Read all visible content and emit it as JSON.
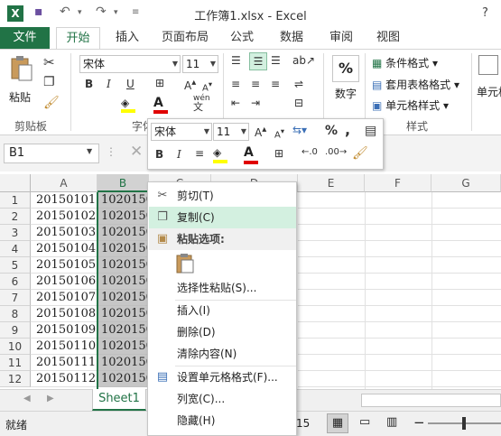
{
  "window": {
    "title": "工作簿1.xlsx - Excel",
    "help": "?"
  },
  "tabs": [
    "文件",
    "开始",
    "插入",
    "页面布局",
    "公式",
    "数据",
    "审阅",
    "视图"
  ],
  "ribbon": {
    "paste_label": "粘贴",
    "clipboard_label": "剪贴板",
    "font_group_label": "字体",
    "font_name": "宋体",
    "font_size": "11",
    "number_label": "数字",
    "cond_format": "条件格式",
    "table_format": "套用表格格式",
    "cell_style": "单元格样式",
    "style_label": "样式",
    "cells_label": "单元格",
    "wen": "wén",
    "percent": "%"
  },
  "formula_bar": {
    "name_box": "B1"
  },
  "columns": [
    "A",
    "B",
    "C",
    "D",
    "E",
    "F",
    "G"
  ],
  "rows": [
    {
      "n": "1",
      "a": "20150101",
      "b": "1020150"
    },
    {
      "n": "2",
      "a": "20150102",
      "b": "1020150"
    },
    {
      "n": "3",
      "a": "20150103",
      "b": "1020150"
    },
    {
      "n": "4",
      "a": "20150104",
      "b": "1020150"
    },
    {
      "n": "5",
      "a": "20150105",
      "b": "1020150"
    },
    {
      "n": "6",
      "a": "20150106",
      "b": "1020150"
    },
    {
      "n": "7",
      "a": "20150107",
      "b": "1020150"
    },
    {
      "n": "8",
      "a": "20150108",
      "b": "1020150"
    },
    {
      "n": "9",
      "a": "20150109",
      "b": "1020150"
    },
    {
      "n": "10",
      "a": "20150110",
      "b": "1020150"
    },
    {
      "n": "11",
      "a": "20150111",
      "b": "1020150"
    },
    {
      "n": "12",
      "a": "20150112",
      "b": "1020150"
    }
  ],
  "mini_toolbar": {
    "font_name": "宋体",
    "font_size": "11",
    "percent": "%",
    "comma": ","
  },
  "context_menu": {
    "cut": "剪切(T)",
    "copy": "复制(C)",
    "paste_options": "粘贴选项:",
    "paste_special": "选择性粘贴(S)...",
    "insert": "插入(I)",
    "delete": "删除(D)",
    "clear": "清除内容(N)",
    "format_cells": "设置单元格格式(F)...",
    "col_width": "列宽(C)...",
    "hide": "隐藏(H)"
  },
  "sheet_tab": "Sheet1",
  "status": {
    "ready": "就绪",
    "count_fragment": "15"
  },
  "colors": {
    "accent": "#217346",
    "selection": "#c6c6c6",
    "highlight": "#d3f0e0"
  }
}
